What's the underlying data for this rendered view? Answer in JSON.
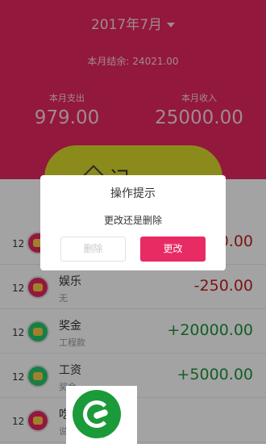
{
  "header": {
    "month": "2017年7月",
    "balance_label": "本月结余:",
    "balance_value": "24021.00",
    "expense_label": "本月支出",
    "expense_value": "979.00",
    "income_label": "本月收入",
    "income_value": "25000.00"
  },
  "record_button": {
    "label": "记一笔"
  },
  "records": [
    {
      "day": "12",
      "category": "",
      "note": "",
      "amount": "0.00"
    },
    {
      "day": "12",
      "category": "娱乐",
      "note": "无",
      "amount": "-250.00"
    },
    {
      "day": "12",
      "category": "奖金",
      "note": "工程款",
      "amount": "+20000.00"
    },
    {
      "day": "12",
      "category": "工资",
      "note": "奖金",
      "amount": "+5000.00"
    },
    {
      "day": "12",
      "category": "吃",
      "note": "说",
      "amount": ""
    }
  ],
  "dialog": {
    "title": "操作提示",
    "message": "更改还是删除",
    "delete_label": "删除",
    "change_label": "更改"
  },
  "colors": {
    "header_bg": "#e2255e",
    "record_button": "#d6d62a",
    "expense_amount": "#c02121",
    "income_amount": "#1f8f3a",
    "dialog_primary": "#e82b62"
  },
  "icons": {
    "caret": "chevron-down-icon",
    "record": "pencil-icon",
    "category_ent": "wallet-icon",
    "category_bonus": "piggy-bank-icon"
  }
}
